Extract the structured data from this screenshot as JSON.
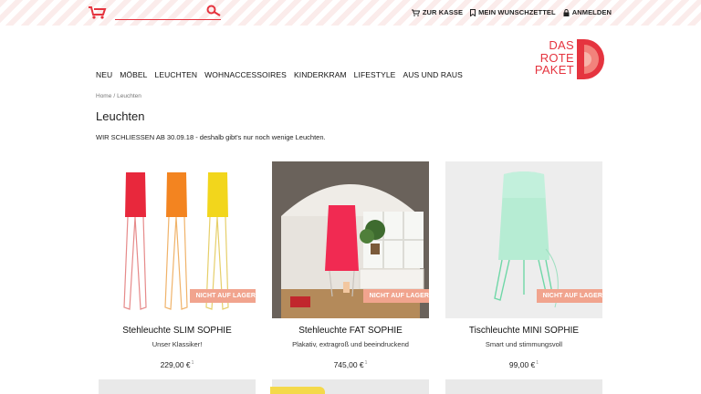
{
  "topbar": {
    "search": {
      "value": "",
      "placeholder": ""
    },
    "links": [
      {
        "icon": "cart-icon",
        "label": "ZUR KASSE"
      },
      {
        "icon": "bookmark-icon",
        "label": "MEIN WUNSCHZETTEL"
      },
      {
        "icon": "lock-icon",
        "label": "ANMELDEN"
      }
    ]
  },
  "brand": {
    "line1": "DAS",
    "line2": "ROTE",
    "line3": "PAKET",
    "color": "#e5343f"
  },
  "nav": [
    "NEU",
    "MÖBEL",
    "LEUCHTEN",
    "WOHNACCESSOIRES",
    "KINDERKRAM",
    "LIFESTYLE",
    "AUS UND RAUS"
  ],
  "breadcrumb": {
    "home": "Home",
    "sep": "/",
    "current": "Leuchten"
  },
  "page": {
    "title": "Leuchten",
    "notice": "WIR SCHLIESSEN AB 30.09.18 - deshalb gibt's nur noch wenige Leuchten."
  },
  "products": [
    {
      "name": "Stehleuchte SLIM SOPHIE",
      "description": "Unser Klassiker!",
      "price": "229,00 €",
      "price_note": "1",
      "badge": "NICHT AUF LAGER"
    },
    {
      "name": "Stehleuchte FAT SOPHIE",
      "description": "Plakativ, extragroß und beeindruckend",
      "price": "745,00 €",
      "price_note": "1",
      "badge": "NICHT AUF LAGER"
    },
    {
      "name": "Tischleuchte MINI SOPHIE",
      "description": "Smart und stimmungsvoll",
      "price": "99,00 €",
      "price_note": "1",
      "badge": "NICHT AUF LAGER"
    }
  ],
  "colors": {
    "accent": "#e5343f",
    "badge": "#f1a48e"
  }
}
